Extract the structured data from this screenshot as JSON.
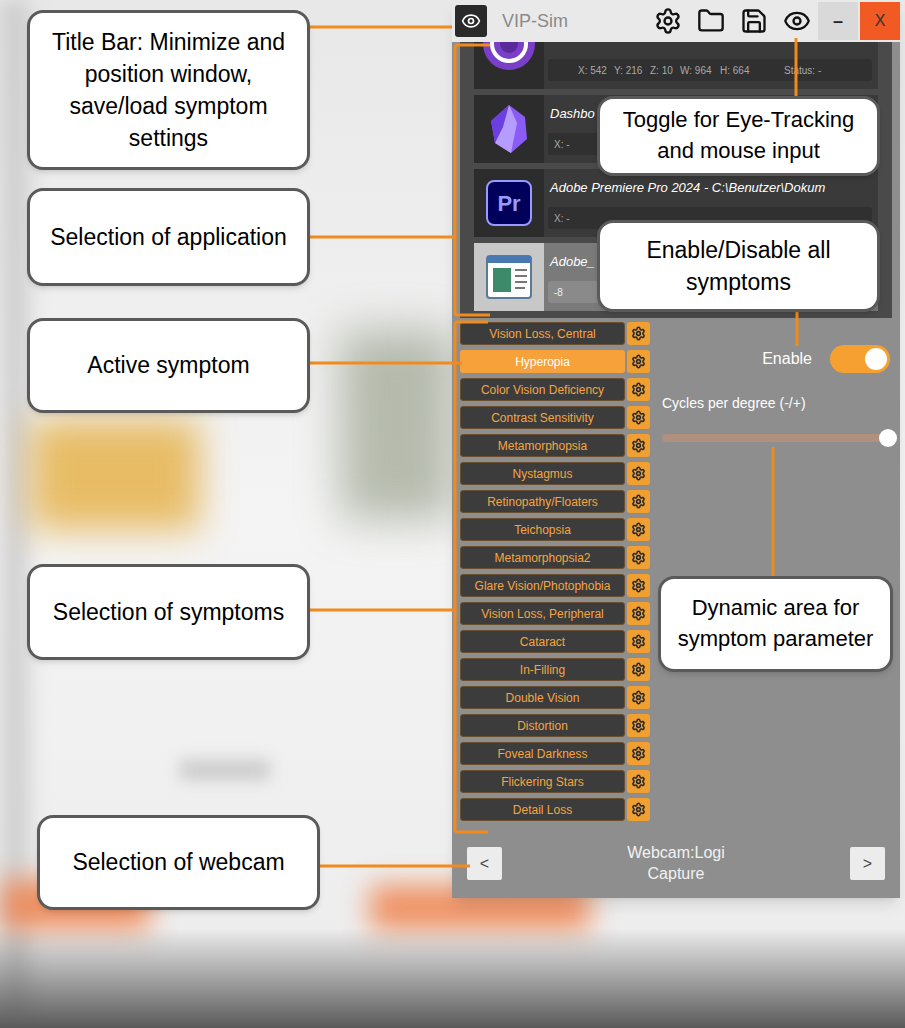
{
  "window": {
    "title": "VIP-Sim",
    "minimize": "–",
    "close": "X"
  },
  "applications": [
    {
      "selected": false,
      "fields": [
        "X: 542",
        "Y: 216",
        "Z: 10",
        "W: 964",
        "H: 664",
        "Status: -"
      ]
    },
    {
      "title": "Dashbo",
      "selected": false,
      "fields": [
        "X: -"
      ]
    },
    {
      "title": "Adobe Premiere Pro 2024 - C:\\Benutzer\\Dokum",
      "logo_text": "Pr",
      "selected": false,
      "fields": [
        "X: -"
      ]
    },
    {
      "title": "Adobe_",
      "selected": true,
      "fields": [
        "-8"
      ]
    }
  ],
  "symptoms": [
    {
      "label": "Vision Loss, Central",
      "selected": false
    },
    {
      "label": "Hyperopia",
      "selected": true
    },
    {
      "label": "Color Vision Deficiency",
      "selected": false
    },
    {
      "label": "Contrast Sensitivity",
      "selected": false
    },
    {
      "label": "Metamorphopsia",
      "selected": false
    },
    {
      "label": "Nystagmus",
      "selected": false
    },
    {
      "label": "Retinopathy/Floaters",
      "selected": false
    },
    {
      "label": "Teichopsia",
      "selected": false
    },
    {
      "label": "Metamorphopsia2",
      "selected": false
    },
    {
      "label": "Glare Vision/Photophobia",
      "selected": false
    },
    {
      "label": "Vision Loss, Peripheral",
      "selected": false
    },
    {
      "label": "Cataract",
      "selected": false
    },
    {
      "label": "In-Filling",
      "selected": false
    },
    {
      "label": "Double Vision",
      "selected": false
    },
    {
      "label": "Distortion",
      "selected": false
    },
    {
      "label": "Foveal Darkness",
      "selected": false
    },
    {
      "label": "Flickering Stars",
      "selected": false
    },
    {
      "label": "Detail Loss",
      "selected": false
    }
  ],
  "parameters": {
    "enable": {
      "label": "Enable",
      "on": true
    },
    "slider": {
      "label": "Cycles per degree (-/+)",
      "level": 1
    }
  },
  "webcam": {
    "prev": "<",
    "label": "Webcam:Logi Capture",
    "next": ">"
  },
  "callouts": [
    {
      "text": "Title Bar: Minimize and position window, save/load symptom settings"
    },
    {
      "text": "Selection of application"
    },
    {
      "text": "Active symptom"
    },
    {
      "text": "Selection of symptoms"
    },
    {
      "text": "Selection of webcam"
    },
    {
      "text": "Toggle for Eye-Tracking and mouse input"
    },
    {
      "text": "Enable/Disable all symptoms"
    },
    {
      "text": "Dynamic area for symptom parameter"
    }
  ]
}
